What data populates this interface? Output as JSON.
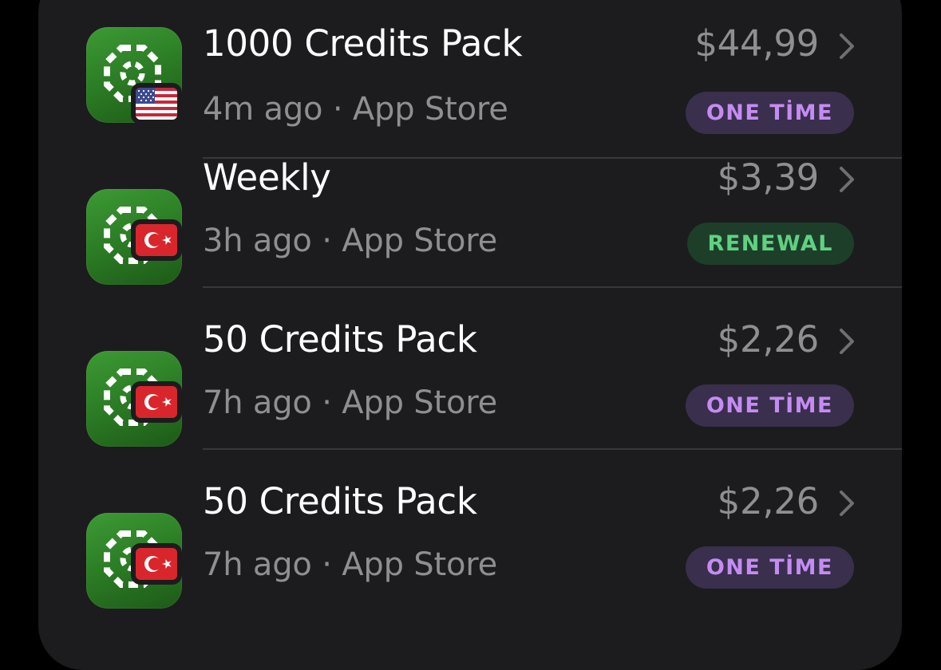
{
  "transactions": [
    {
      "title": "1000 Credits Pack",
      "time": "4m ago",
      "store": "App Store",
      "price": "$44,99",
      "badge": "ONE TİME",
      "badge_type": "one-time",
      "country_flag": "us-flag-icon"
    },
    {
      "title": "Weekly",
      "time": "3h ago",
      "store": "App Store",
      "price": "$3,39",
      "badge": "RENEWAL",
      "badge_type": "renewal",
      "country_flag": "turkey-flag-icon"
    },
    {
      "title": "50 Credits Pack",
      "time": "7h ago",
      "store": "App Store",
      "price": "$2,26",
      "badge": "ONE TİME",
      "badge_type": "one-time",
      "country_flag": "turkey-flag-icon"
    },
    {
      "title": "50 Credits Pack",
      "time": "7h ago",
      "store": "App Store",
      "price": "$2,26",
      "badge": "ONE TİME",
      "badge_type": "one-time",
      "country_flag": "turkey-flag-icon"
    }
  ],
  "separator": " · ",
  "colors": {
    "card_background": "#1c1c1e",
    "one_time_badge_bg": "#3a2f4d",
    "one_time_badge_text": "#c48cf2",
    "renewal_badge_bg": "#1d3f2a",
    "renewal_badge_text": "#5fd181",
    "app_icon_green": "#3c9a34"
  }
}
